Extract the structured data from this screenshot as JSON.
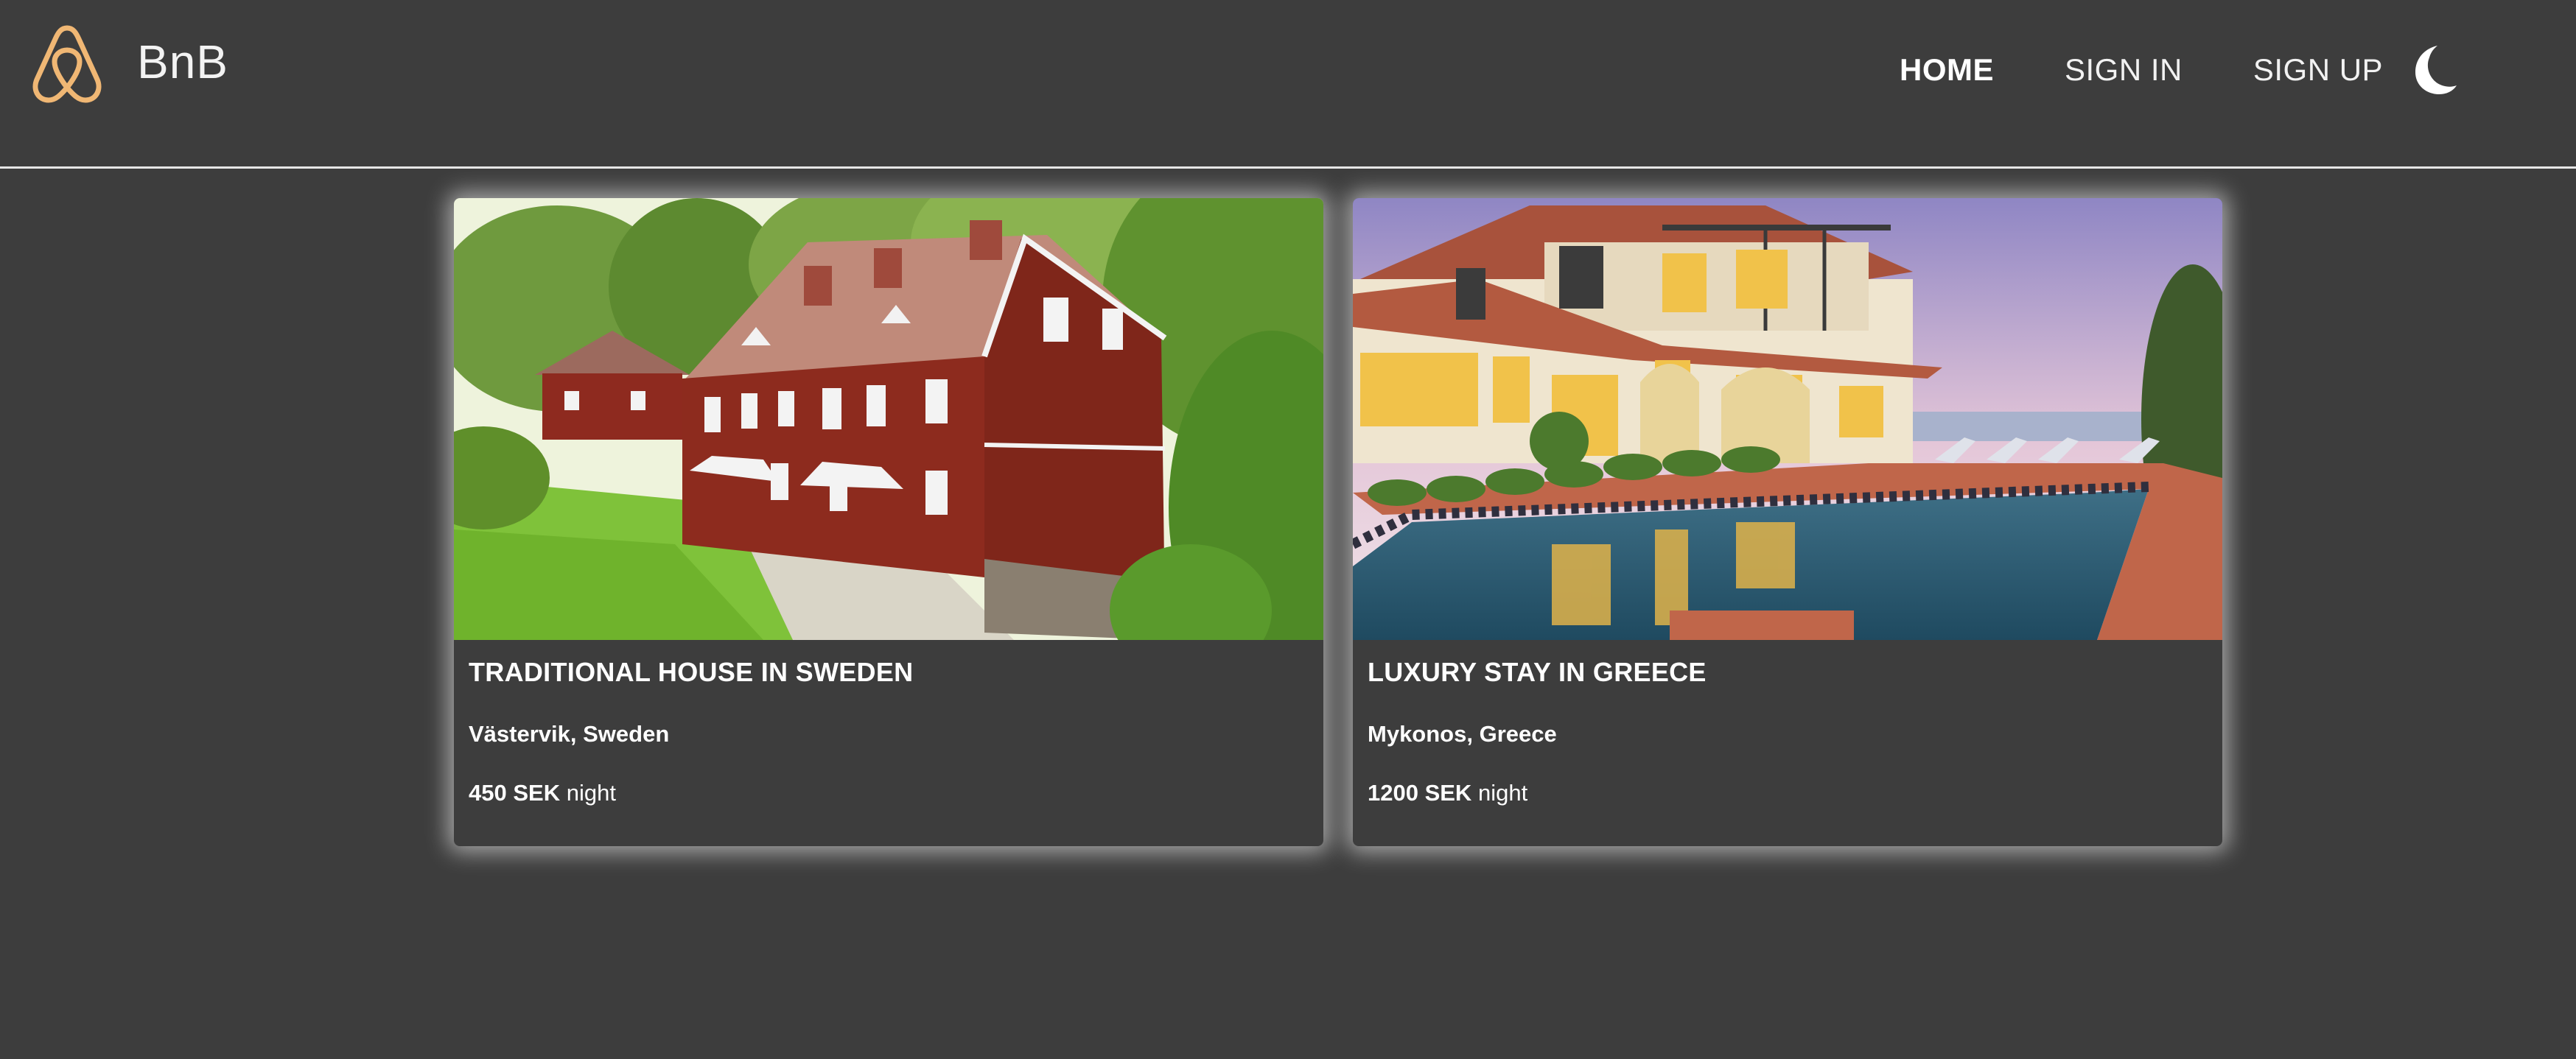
{
  "header": {
    "brand_name": "BnB",
    "brand_color": "#f0b774",
    "logo_icon": "airbnb-belo-icon",
    "nav": [
      {
        "label": "HOME",
        "active": true
      },
      {
        "label": "SIGN IN",
        "active": false
      },
      {
        "label": "SIGN UP",
        "active": false
      }
    ],
    "theme_toggle_icon": "moon-icon"
  },
  "listings": [
    {
      "title": "TRADITIONAL HOUSE IN SWEDEN",
      "location": "Västervik, Sweden",
      "price": "450 SEK",
      "price_unit": "night",
      "image": "red-swedish-farmhouse-photo"
    },
    {
      "title": "LUXURY STAY IN GREECE",
      "location": "Mykonos, Greece",
      "price": "1200 SEK",
      "price_unit": "night",
      "image": "greek-villa-pool-photo"
    }
  ],
  "colors": {
    "background": "#3d3d3d",
    "text": "#ffffff",
    "divider": "#e6e6e6"
  }
}
